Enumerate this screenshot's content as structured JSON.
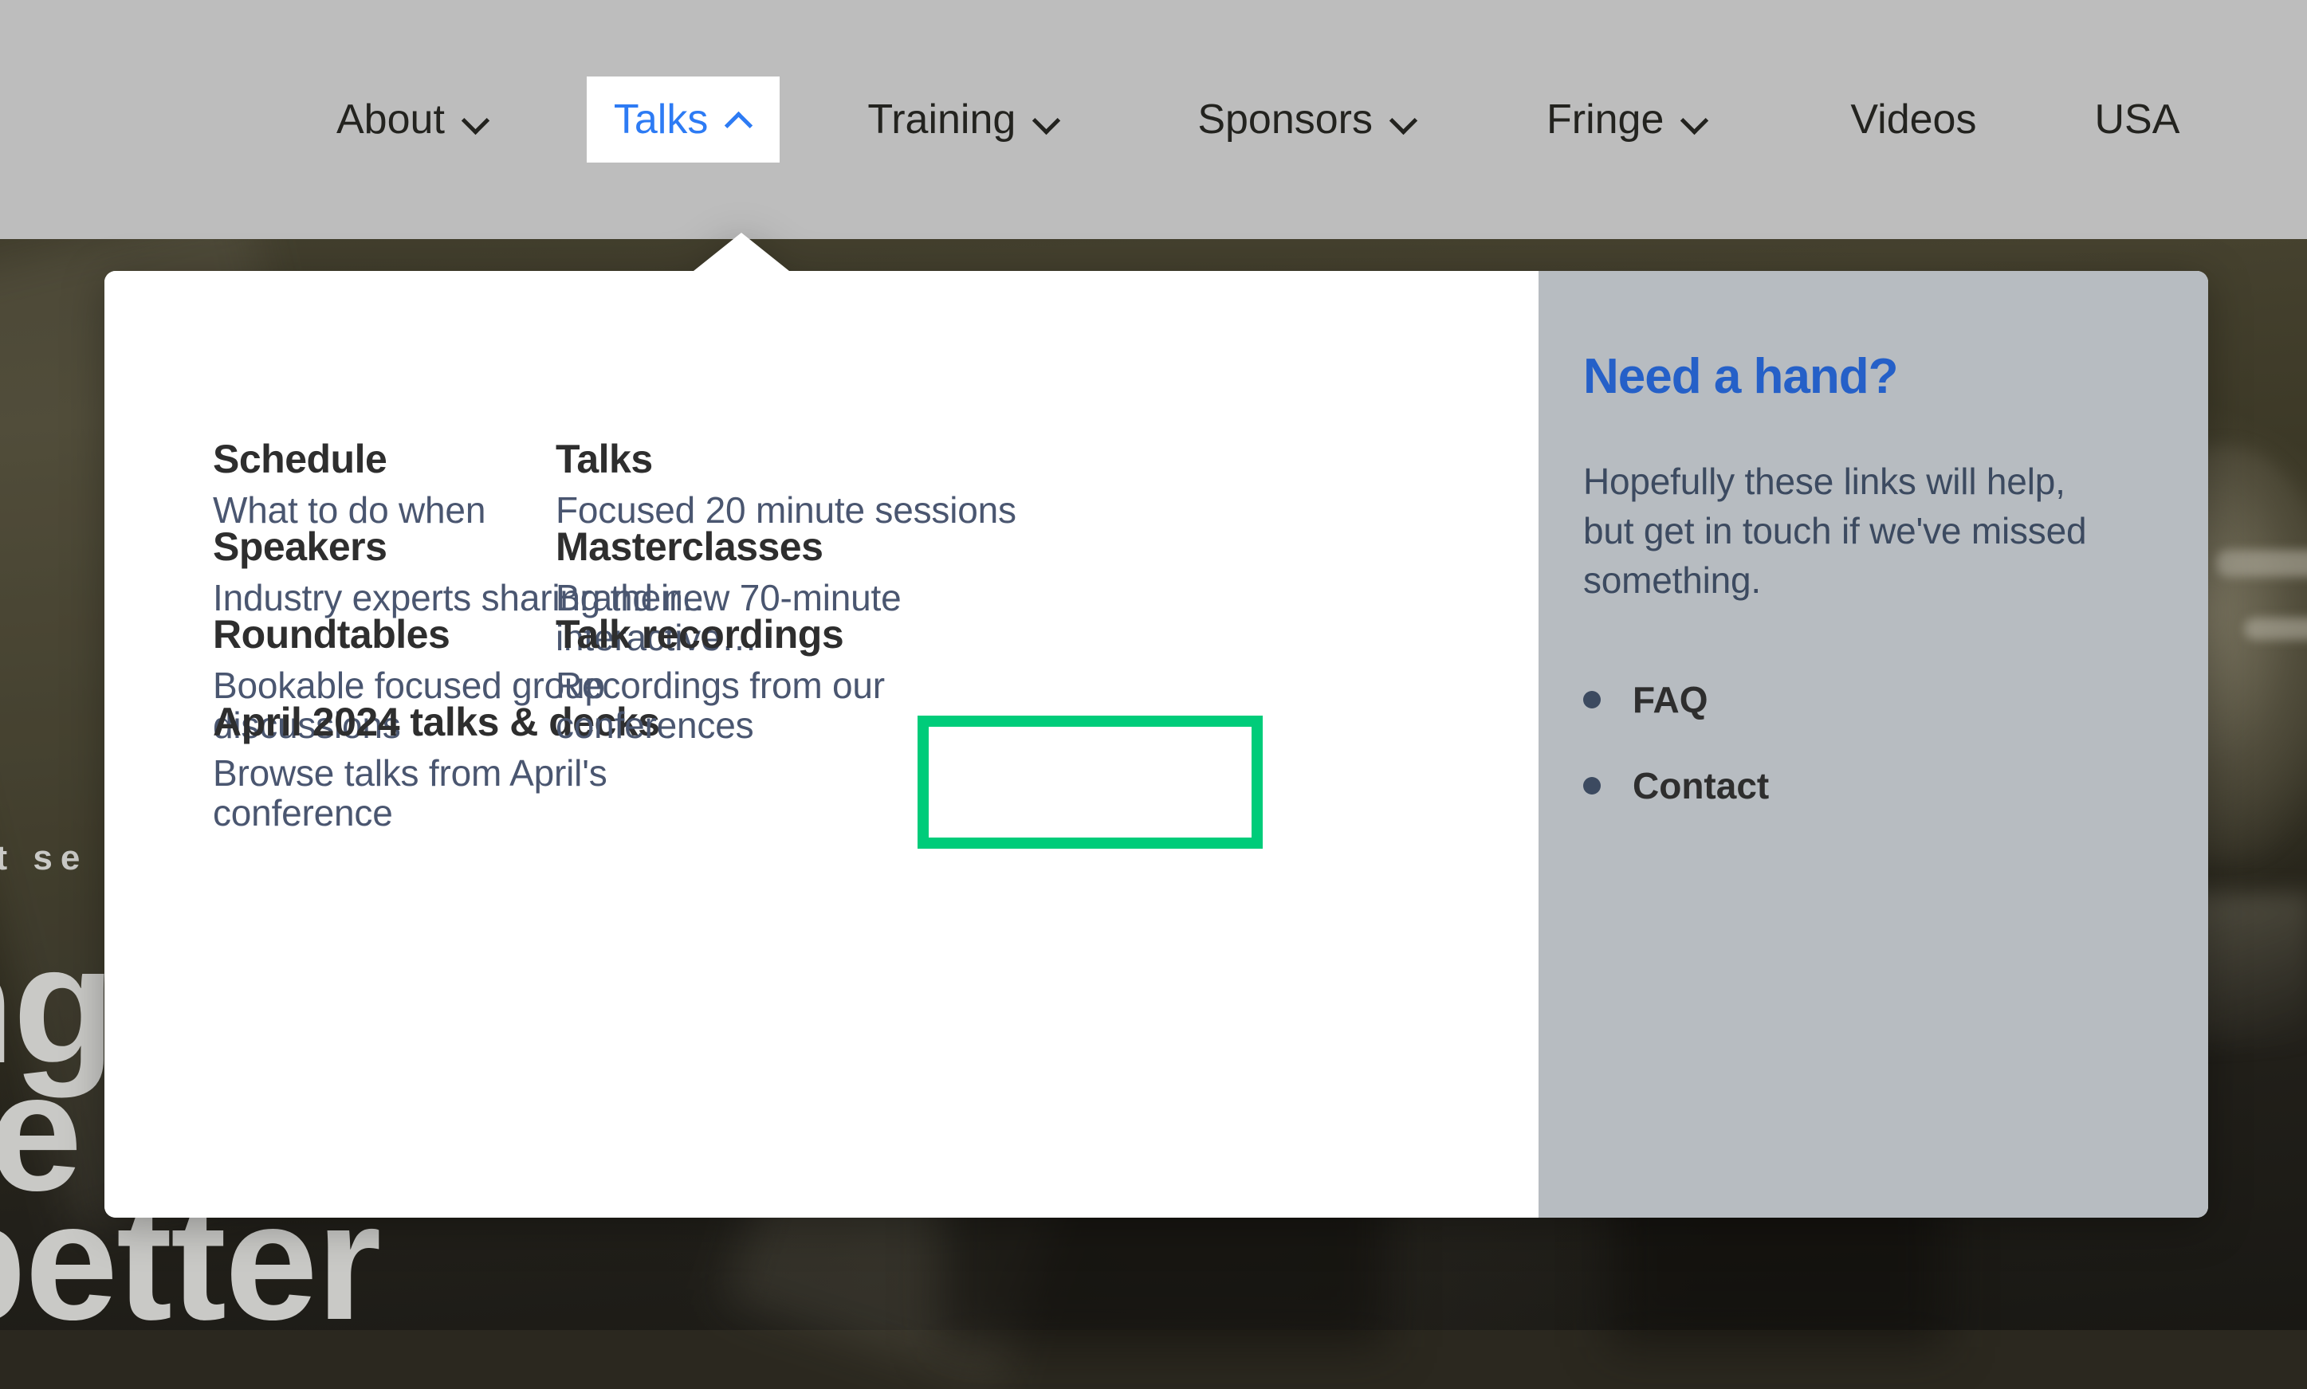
{
  "nav": {
    "items": [
      {
        "label": "About",
        "icon": "chevron-down-icon",
        "has_caret": true,
        "active": false
      },
      {
        "label": "Talks",
        "icon": "chevron-up-icon",
        "has_caret": true,
        "active": true
      },
      {
        "label": "Training",
        "icon": "chevron-down-icon",
        "has_caret": true,
        "active": false
      },
      {
        "label": "Sponsors",
        "icon": "chevron-down-icon",
        "has_caret": true,
        "active": false
      },
      {
        "label": "Fringe",
        "icon": "chevron-down-icon",
        "has_caret": true,
        "active": false
      },
      {
        "label": "Videos",
        "icon": "",
        "has_caret": false,
        "active": false
      },
      {
        "label": "USA",
        "icon": "",
        "has_caret": false,
        "active": false
      }
    ]
  },
  "megamenu": {
    "left_column": [
      {
        "title": "Schedule",
        "desc": "What to do when"
      },
      {
        "title": "Speakers",
        "desc": "Industry experts sharing their…"
      },
      {
        "title": "Roundtables",
        "desc": "Bookable focused group discussions"
      },
      {
        "title": "April 2024 talks & decks",
        "desc": "Browse talks from April's conference"
      }
    ],
    "middle_column": [
      {
        "title": "Talks",
        "desc": "Focused 20 minute sessions",
        "highlighted": true
      },
      {
        "title": "Masterclasses",
        "desc": "Brand new 70-minute interactive…",
        "highlighted": false
      },
      {
        "title": "Talk recordings",
        "desc": "Recordings from our conferences",
        "highlighted": false
      }
    ],
    "aside": {
      "title": "Need a hand?",
      "text": "Hopefully these links will help, but get in touch if we've missed something.",
      "links": [
        "FAQ",
        "Contact"
      ]
    }
  },
  "background": {
    "kicker": "st se",
    "line1": "ng",
    "line2": "le",
    "line3": "better"
  },
  "colors": {
    "highlight_green": "#00cc7a",
    "nav_active_text": "#2d7bf4",
    "aside_title_blue": "#2560c8",
    "desc_text": "#4a5670",
    "nav_bar_bg": "#bdbdbd",
    "aside_bg": "#b7bcc1"
  }
}
